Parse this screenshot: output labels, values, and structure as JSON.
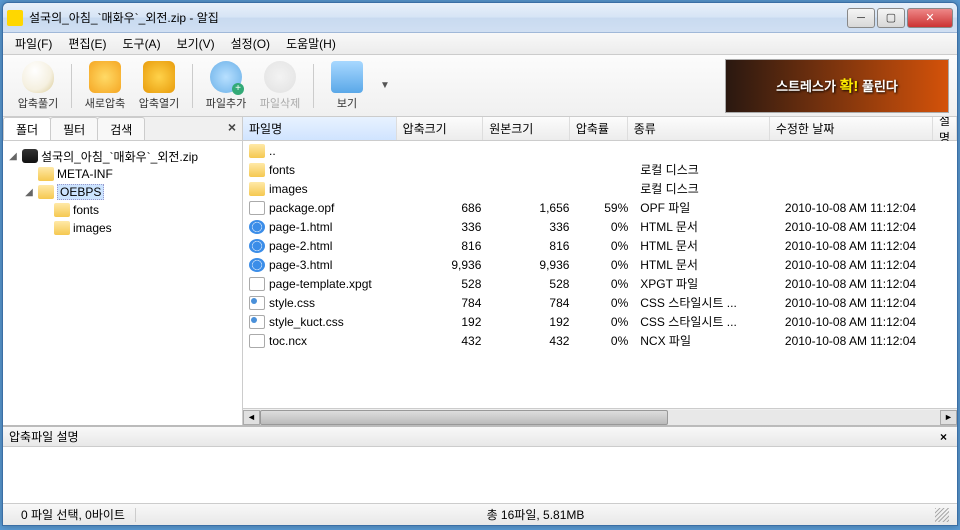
{
  "window": {
    "title": "설국의_아침_`매화우`_외전.zip - 알집"
  },
  "menu": {
    "file": "파일(F)",
    "edit": "편집(E)",
    "tools": "도구(A)",
    "view": "보기(V)",
    "settings": "설정(O)",
    "help": "도움말(H)"
  },
  "toolbar": {
    "extract": "압축풀기",
    "new": "새로압축",
    "open": "압축열기",
    "add": "파일추가",
    "delete": "파일삭제",
    "view": "보기"
  },
  "ad": {
    "line1": "스트레스가",
    "accent": "확!",
    "line2": "풀린다"
  },
  "tabs": {
    "folder": "폴더",
    "filter": "필터",
    "search": "검색"
  },
  "tree": {
    "root": "설국의_아침_`매화우`_외전.zip",
    "n1": "META-INF",
    "n2": "OEBPS",
    "n3": "fonts",
    "n4": "images"
  },
  "columns": {
    "name": "파일명",
    "comp": "압축크기",
    "orig": "원본크기",
    "ratio": "압축률",
    "type": "종류",
    "date": "수정한 날짜",
    "desc": "설명"
  },
  "files": [
    {
      "name": "..",
      "icon": "folder",
      "comp": "",
      "orig": "",
      "ratio": "",
      "type": "",
      "date": ""
    },
    {
      "name": "fonts",
      "icon": "folder",
      "comp": "",
      "orig": "",
      "ratio": "",
      "type": "로컬 디스크",
      "date": ""
    },
    {
      "name": "images",
      "icon": "folder",
      "comp": "",
      "orig": "",
      "ratio": "",
      "type": "로컬 디스크",
      "date": ""
    },
    {
      "name": "package.opf",
      "icon": "file",
      "comp": "686",
      "orig": "1,656",
      "ratio": "59%",
      "type": "OPF 파일",
      "date": "2010-10-08 AM 11:12:04"
    },
    {
      "name": "page-1.html",
      "icon": "ie",
      "comp": "336",
      "orig": "336",
      "ratio": "0%",
      "type": "HTML 문서",
      "date": "2010-10-08 AM 11:12:04"
    },
    {
      "name": "page-2.html",
      "icon": "ie",
      "comp": "816",
      "orig": "816",
      "ratio": "0%",
      "type": "HTML 문서",
      "date": "2010-10-08 AM 11:12:04"
    },
    {
      "name": "page-3.html",
      "icon": "ie",
      "comp": "9,936",
      "orig": "9,936",
      "ratio": "0%",
      "type": "HTML 문서",
      "date": "2010-10-08 AM 11:12:04"
    },
    {
      "name": "page-template.xpgt",
      "icon": "file",
      "comp": "528",
      "orig": "528",
      "ratio": "0%",
      "type": "XPGT 파일",
      "date": "2010-10-08 AM 11:12:04"
    },
    {
      "name": "style.css",
      "icon": "css",
      "comp": "784",
      "orig": "784",
      "ratio": "0%",
      "type": "CSS 스타일시트 ...",
      "date": "2010-10-08 AM 11:12:04"
    },
    {
      "name": "style_kuct.css",
      "icon": "css",
      "comp": "192",
      "orig": "192",
      "ratio": "0%",
      "type": "CSS 스타일시트 ...",
      "date": "2010-10-08 AM 11:12:04"
    },
    {
      "name": "toc.ncx",
      "icon": "file",
      "comp": "432",
      "orig": "432",
      "ratio": "0%",
      "type": "NCX 파일",
      "date": "2010-10-08 AM 11:12:04"
    }
  ],
  "desc_panel": {
    "title": "압축파일 설명"
  },
  "status": {
    "left": "0 파일 선택, 0바이트",
    "right": "총 16파일, 5.81MB"
  }
}
